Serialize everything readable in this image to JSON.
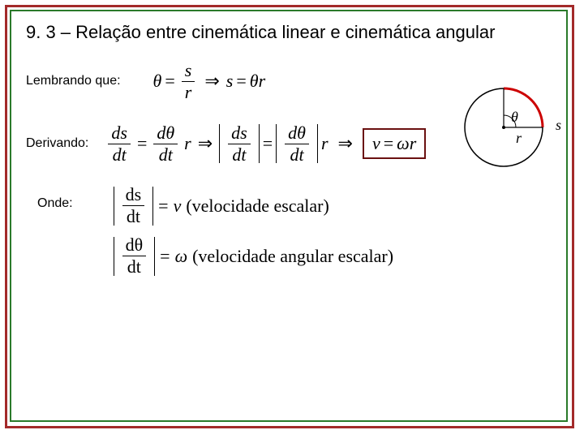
{
  "title": "9. 3 – Relação entre cinemática linear e cinemática angular",
  "labels": {
    "lembrando": "Lembrando que:",
    "derivando": "Derivando:",
    "onde": "Onde:"
  },
  "eq1": {
    "lhs_num": "s",
    "lhs_den": "r",
    "theta": "θ",
    "eq": "=",
    "arrow": "⇒",
    "rhs_lhs": "s",
    "rhs_rhs1": "θ",
    "rhs_rhs2": "r"
  },
  "eq2": {
    "d1_num": "ds",
    "d1_den": "dt",
    "d2_num": "dθ",
    "d2_den": "dt",
    "r": "r",
    "eq": "=",
    "arrow": "⇒",
    "boxed_lhs": "v",
    "boxed_rhs1": "ω",
    "boxed_rhs2": "r"
  },
  "defs": {
    "d1_num": "ds",
    "d1_den": "dt",
    "d1_sym": "v",
    "d1_txt": "(velocidade escalar)",
    "d2_num": "dθ",
    "d2_den": "dt",
    "d2_sym": "ω",
    "d2_txt": "(velocidade angular escalar)",
    "eq": "="
  },
  "diagram": {
    "theta": "θ",
    "r": "r",
    "s": "s"
  }
}
